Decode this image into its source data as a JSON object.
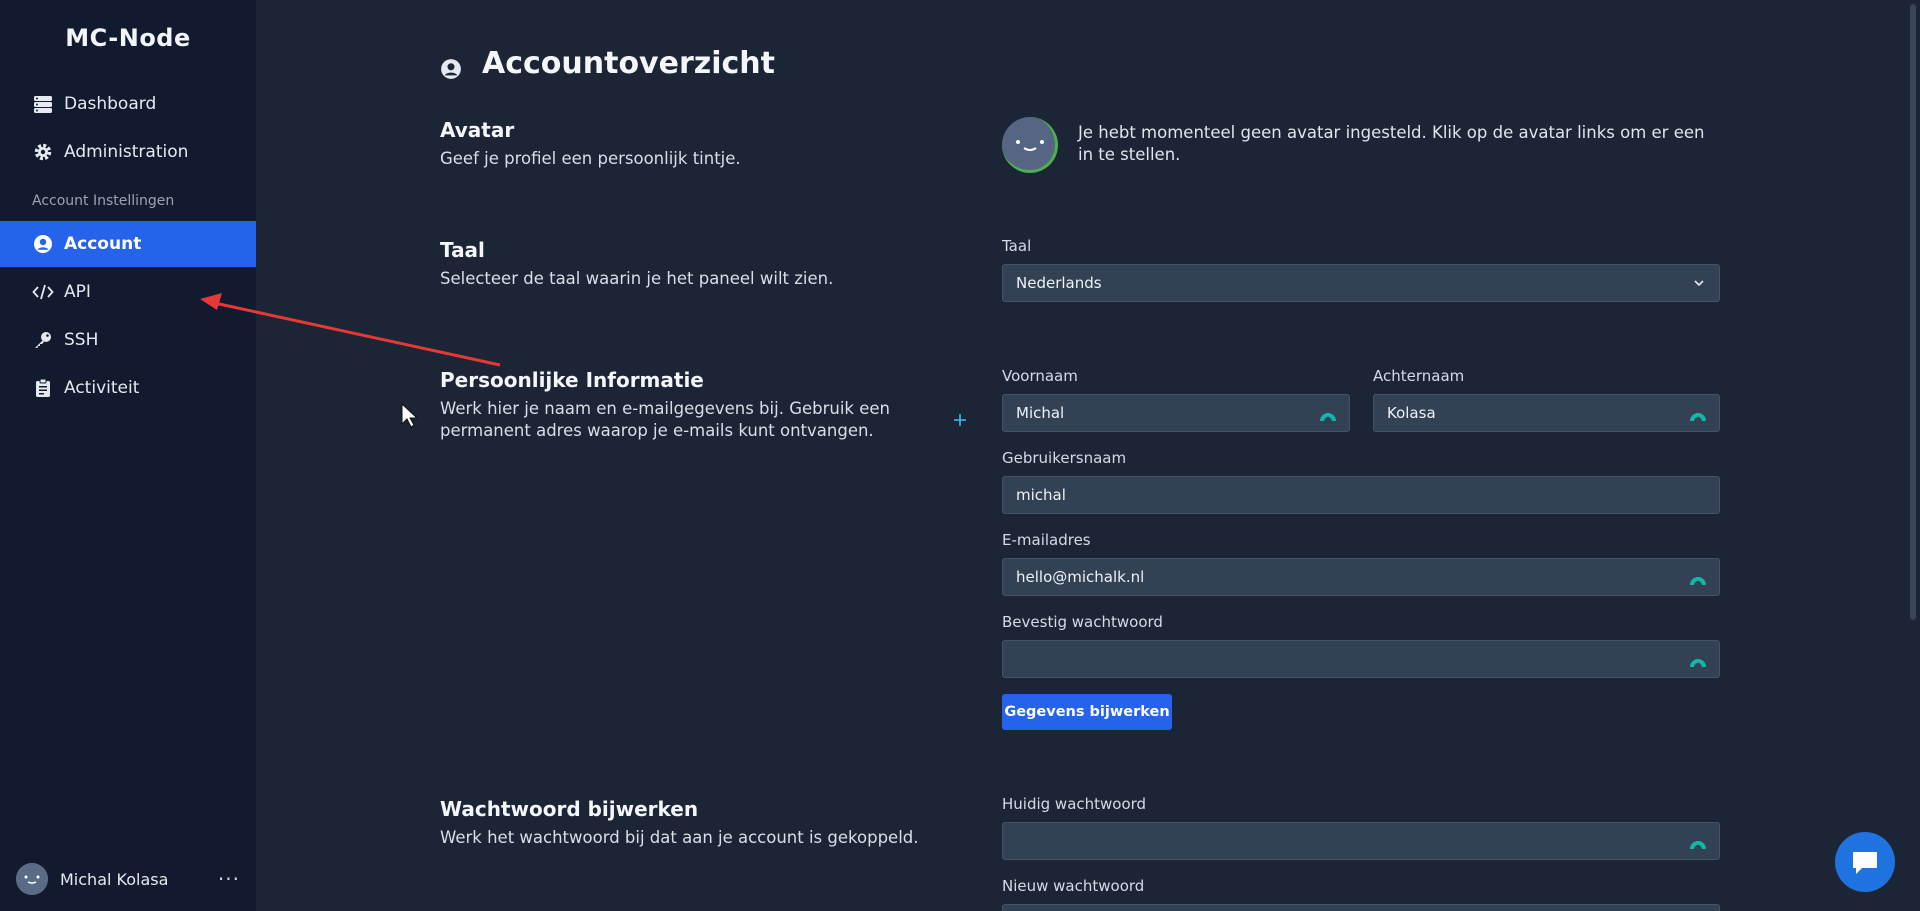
{
  "brand": "MC-Node",
  "nav": {
    "dashboard": "Dashboard",
    "administration": "Administration",
    "section": "Account Instellingen",
    "account": "Account",
    "api": "API",
    "ssh": "SSH",
    "activity": "Activiteit"
  },
  "user": {
    "name": "Michal Kolasa",
    "menu": "···"
  },
  "page": {
    "title": "Accountoverzicht",
    "avatar": {
      "title": "Avatar",
      "desc": "Geef je profiel een persoonlijk tintje.",
      "msg": "Je hebt momenteel geen avatar ingesteld. Klik op de avatar links om er een in te stellen."
    },
    "language": {
      "title": "Taal",
      "desc": "Selecteer de taal waarin je het paneel wilt zien.",
      "label": "Taal",
      "value": "Nederlands"
    },
    "personal": {
      "title": "Persoonlijke Informatie",
      "desc": "Werk hier je naam en e-mailgegevens bij. Gebruik een permanent adres waarop je e-mails kunt ontvangen.",
      "first_label": "Voornaam",
      "first_value": "Michal",
      "last_label": "Achternaam",
      "last_value": "Kolasa",
      "username_label": "Gebruikersnaam",
      "username_value": "michal",
      "email_label": "E-mailadres",
      "email_value": "hello@michalk.nl",
      "confirm_label": "Bevestig wachtwoord",
      "confirm_value": "",
      "button": "Gegevens bijwerken"
    },
    "password": {
      "title": "Wachtwoord bijwerken",
      "desc": "Werk het wachtwoord bij dat aan je account is gekoppeld.",
      "current_label": "Huidig wachtwoord",
      "current_value": "",
      "new_label": "Nieuw wachtwoord"
    }
  },
  "colors": {
    "accent": "#2563eb",
    "sidebar": "#111a2e",
    "background": "#1c2536",
    "field": "#334155",
    "annotation": "#e53935"
  }
}
